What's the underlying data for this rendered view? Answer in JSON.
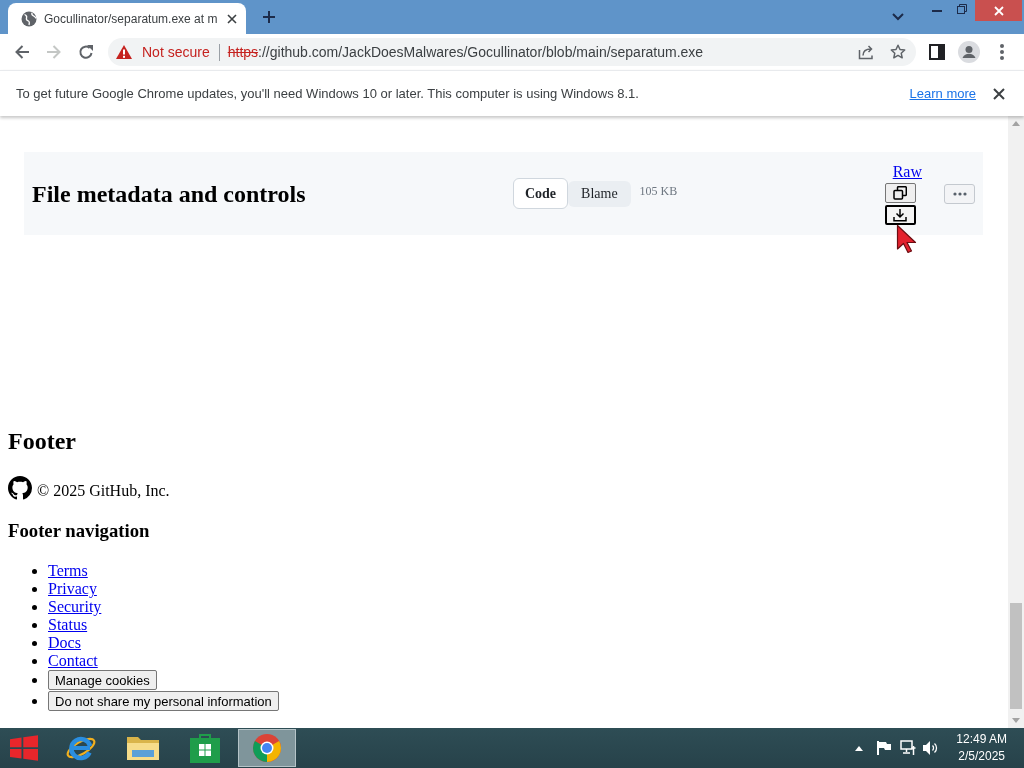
{
  "browser": {
    "tabs": [
      {
        "title": "Gocullinator/separatum.exe at m",
        "selected": true
      }
    ],
    "address_bar": {
      "security_label": "Not secure",
      "scheme": "https",
      "url": "://github.com/JackDoesMalwares/Gocullinator/blob/main/separatum.exe"
    }
  },
  "info_bar": {
    "message": "To get future Google Chrome updates, you'll need Windows 10 or later. This computer is using Windows 8.1.",
    "link": "Learn more"
  },
  "file_header": {
    "title": "File metadata and controls",
    "view_tabs": [
      {
        "label": "Code",
        "selected": true
      },
      {
        "label": "Blame",
        "selected": false
      }
    ],
    "size": "105 KB",
    "raw_link": "Raw",
    "actions": [
      {
        "kind": "copy",
        "focused": false
      },
      {
        "kind": "download",
        "focused": true
      }
    ]
  },
  "footer": {
    "heading": "Footer",
    "copyright": "© 2025 GitHub, Inc.",
    "nav_heading": "Footer navigation",
    "nav_items": [
      {
        "kind": "link",
        "label": "Terms"
      },
      {
        "kind": "link",
        "label": "Privacy"
      },
      {
        "kind": "link",
        "label": "Security"
      },
      {
        "kind": "link",
        "label": "Status"
      },
      {
        "kind": "link",
        "label": "Docs"
      },
      {
        "kind": "link",
        "label": "Contact"
      },
      {
        "kind": "button",
        "label": "Manage cookies"
      },
      {
        "kind": "button",
        "label": "Do not share my personal information"
      }
    ]
  },
  "taskbar": {
    "apps": [
      {
        "selected": false
      },
      {
        "selected": false
      },
      {
        "selected": false
      },
      {
        "selected": true
      }
    ],
    "clock_time": "12:49 AM",
    "clock_date": "2/5/2025"
  }
}
